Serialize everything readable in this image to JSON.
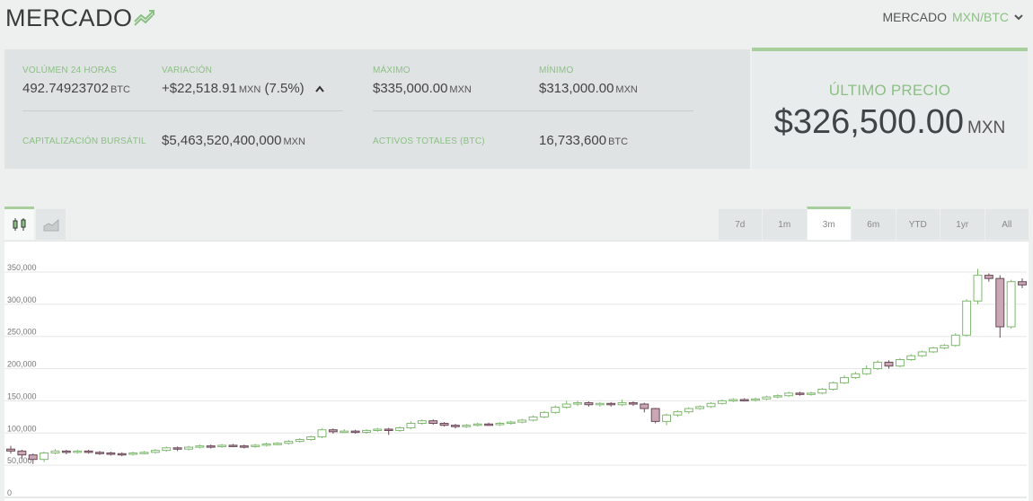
{
  "header": {
    "title": "MERCADO",
    "market_label": "MERCADO",
    "market_pair": "MXN/BTC"
  },
  "stats": {
    "volume": {
      "label": "VOLÚMEN 24 HORAS",
      "value": "492.74923702",
      "unit": "BTC"
    },
    "variation": {
      "label": "VARIACIÓN",
      "value": "+$22,518.91",
      "unit": "MXN",
      "percent": "(7.5%)"
    },
    "max": {
      "label": "MÁXIMO",
      "value": "$335,000.00",
      "unit": "MXN"
    },
    "min": {
      "label": "MÍNIMO",
      "value": "$313,000.00",
      "unit": "MXN"
    },
    "market_cap": {
      "label": "CAPITALIZACIÓN BURSÁTIL",
      "value": "$5,463,520,400,000",
      "unit": "MXN"
    },
    "total_assets": {
      "label": "ACTIVOS TOTALES (BTC)",
      "value": "16,733,600",
      "unit": "BTC"
    }
  },
  "last_price": {
    "label": "ÚLTIMO PRECIO",
    "value": "$326,500.00",
    "unit": "MXN"
  },
  "toolbar": {
    "chart_types": [
      {
        "icon": "candlestick-icon",
        "active": true
      },
      {
        "icon": "area-chart-icon",
        "active": false
      }
    ],
    "ranges": [
      {
        "label": "7d",
        "active": false
      },
      {
        "label": "1m",
        "active": false
      },
      {
        "label": "3m",
        "active": true
      },
      {
        "label": "6m",
        "active": false
      },
      {
        "label": "YTD",
        "active": false
      },
      {
        "label": "1yr",
        "active": false
      },
      {
        "label": "All",
        "active": false
      }
    ]
  },
  "colors": {
    "accent": "#8cc084",
    "up_candle": "#7fb86f",
    "down_candle_fill": "#c9a7b4",
    "down_candle_stroke": "#6a4a58",
    "grid": "#e6e6e6"
  },
  "chart_data": {
    "type": "candlestick",
    "ylim": [
      0,
      350000
    ],
    "y_ticks": [
      0,
      50000,
      100000,
      150000,
      200000,
      250000,
      300000,
      350000
    ],
    "y_tick_labels": [
      "0",
      "50,000",
      "100,000",
      "150,000",
      "200,000",
      "250,000",
      "300,000",
      "350,000"
    ],
    "grid": true,
    "candles": [
      [
        75000,
        72000,
        80000,
        68000
      ],
      [
        72000,
        66000,
        74000,
        60000
      ],
      [
        66000,
        59000,
        68000,
        52000
      ],
      [
        59000,
        69000,
        71000,
        55000
      ],
      [
        69000,
        72000,
        75000,
        67000
      ],
      [
        72000,
        70000,
        74000,
        67000
      ],
      [
        70000,
        72000,
        74000,
        68000
      ],
      [
        72000,
        70000,
        74000,
        68000
      ],
      [
        70000,
        69000,
        72000,
        66000
      ],
      [
        69000,
        68000,
        71000,
        65000
      ],
      [
        68000,
        67000,
        70000,
        64000
      ],
      [
        67000,
        69000,
        71000,
        65000
      ],
      [
        69000,
        70000,
        72000,
        67000
      ],
      [
        70000,
        73000,
        75000,
        68000
      ],
      [
        73000,
        77000,
        79000,
        71000
      ],
      [
        77000,
        75000,
        79000,
        72000
      ],
      [
        75000,
        78000,
        80000,
        73000
      ],
      [
        78000,
        80000,
        82000,
        76000
      ],
      [
        80000,
        79000,
        82000,
        76000
      ],
      [
        79000,
        81000,
        83000,
        77000
      ],
      [
        81000,
        80000,
        83000,
        78000
      ],
      [
        80000,
        79000,
        82000,
        76000
      ],
      [
        79000,
        81000,
        83000,
        77000
      ],
      [
        81000,
        83000,
        85000,
        79000
      ],
      [
        83000,
        84000,
        86000,
        81000
      ],
      [
        84000,
        87000,
        89000,
        82000
      ],
      [
        87000,
        90000,
        92000,
        85000
      ],
      [
        90000,
        94000,
        96000,
        88000
      ],
      [
        94000,
        105000,
        107000,
        92000
      ],
      [
        105000,
        102000,
        107000,
        99000
      ],
      [
        102000,
        103000,
        106000,
        100000
      ],
      [
        103000,
        101000,
        105000,
        99000
      ],
      [
        101000,
        104000,
        106000,
        99000
      ],
      [
        104000,
        106000,
        108000,
        102000
      ],
      [
        106000,
        104000,
        108000,
        97000
      ],
      [
        104000,
        108000,
        110000,
        102000
      ],
      [
        108000,
        115000,
        118000,
        106000
      ],
      [
        115000,
        119000,
        121000,
        113000
      ],
      [
        119000,
        115000,
        121000,
        113000
      ],
      [
        115000,
        112000,
        117000,
        110000
      ],
      [
        112000,
        110000,
        114000,
        107000
      ],
      [
        110000,
        112000,
        114000,
        108000
      ],
      [
        112000,
        114000,
        116000,
        110000
      ],
      [
        114000,
        113000,
        116000,
        111000
      ],
      [
        113000,
        115000,
        117000,
        111000
      ],
      [
        115000,
        117000,
        119000,
        113000
      ],
      [
        117000,
        120000,
        122000,
        115000
      ],
      [
        120000,
        125000,
        127000,
        118000
      ],
      [
        125000,
        132000,
        134000,
        123000
      ],
      [
        132000,
        140000,
        143000,
        130000
      ],
      [
        140000,
        145000,
        150000,
        138000
      ],
      [
        145000,
        147000,
        150000,
        142000
      ],
      [
        147000,
        144000,
        149000,
        141000
      ],
      [
        144000,
        146000,
        148000,
        141000
      ],
      [
        146000,
        144000,
        148000,
        141000
      ],
      [
        144000,
        147000,
        152000,
        142000
      ],
      [
        147000,
        145000,
        149000,
        142000
      ],
      [
        145000,
        138000,
        147000,
        132000
      ],
      [
        138000,
        118000,
        139000,
        115000
      ],
      [
        118000,
        128000,
        130000,
        112000
      ],
      [
        128000,
        133000,
        135000,
        125000
      ],
      [
        133000,
        138000,
        140000,
        130000
      ],
      [
        138000,
        141000,
        143000,
        136000
      ],
      [
        141000,
        146000,
        148000,
        139000
      ],
      [
        146000,
        150000,
        152000,
        144000
      ],
      [
        150000,
        152000,
        154000,
        148000
      ],
      [
        152000,
        151000,
        154000,
        149000
      ],
      [
        151000,
        153000,
        155000,
        149000
      ],
      [
        153000,
        156000,
        158000,
        151000
      ],
      [
        156000,
        158000,
        160000,
        154000
      ],
      [
        158000,
        162000,
        164000,
        156000
      ],
      [
        162000,
        160000,
        164000,
        158000
      ],
      [
        160000,
        162000,
        164000,
        158000
      ],
      [
        162000,
        168000,
        170000,
        160000
      ],
      [
        168000,
        178000,
        180000,
        166000
      ],
      [
        178000,
        186000,
        190000,
        176000
      ],
      [
        186000,
        192000,
        195000,
        184000
      ],
      [
        192000,
        200000,
        205000,
        190000
      ],
      [
        200000,
        210000,
        213000,
        198000
      ],
      [
        210000,
        204000,
        213000,
        200000
      ],
      [
        204000,
        214000,
        216000,
        202000
      ],
      [
        214000,
        220000,
        222000,
        212000
      ],
      [
        220000,
        226000,
        228000,
        218000
      ],
      [
        226000,
        232000,
        234000,
        224000
      ],
      [
        232000,
        236000,
        238000,
        230000
      ],
      [
        236000,
        252000,
        255000,
        234000
      ],
      [
        252000,
        305000,
        308000,
        250000
      ],
      [
        305000,
        345000,
        355000,
        300000
      ],
      [
        345000,
        340000,
        348000,
        335000
      ],
      [
        340000,
        265000,
        345000,
        248000
      ],
      [
        265000,
        335000,
        338000,
        262000
      ],
      [
        335000,
        330000,
        340000,
        325000
      ]
    ]
  }
}
